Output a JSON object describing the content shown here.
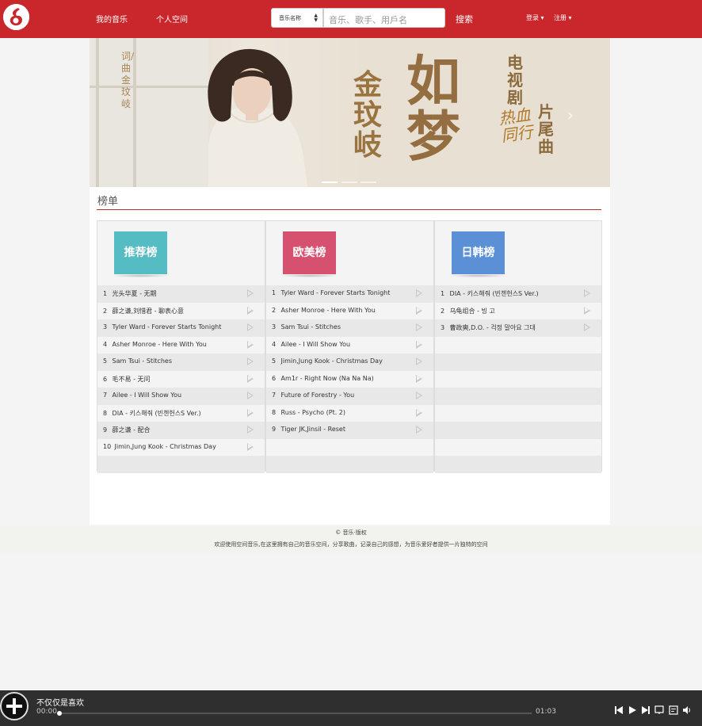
{
  "nav": {
    "my_music": "我的音乐",
    "personal_space": "个人空间",
    "search_type": "音乐名称",
    "search_placeholder": "音乐、歌手、用戶名",
    "search_button": "搜索",
    "login": "登录",
    "register": "注册"
  },
  "banner": {
    "lyricist": "词/曲 金玟岐",
    "singer": "金玟岐",
    "song": "如梦",
    "drama": "电视剧",
    "drama_name": "热血同行",
    "type": "片尾曲"
  },
  "section_title": "榜单",
  "boards": [
    {
      "name": "推荐榜",
      "color": "#55bcc3",
      "songs": [
        {
          "num": "1",
          "title": "光头华夏 - 无期"
        },
        {
          "num": "2",
          "title": "薛之谦,刘惜君 - 聊表心意"
        },
        {
          "num": "3",
          "title": "Tyler Ward - Forever Starts Tonight"
        },
        {
          "num": "4",
          "title": "Asher Monroe - Here With You"
        },
        {
          "num": "5",
          "title": "Sam Tsui - Stitches"
        },
        {
          "num": "6",
          "title": "毛不易 - 无问"
        },
        {
          "num": "7",
          "title": "Ailee - I Will Show You"
        },
        {
          "num": "8",
          "title": "DIA - 키스해줘 (빈첸헌스S Ver.)"
        },
        {
          "num": "9",
          "title": "薛之谦 - 配合"
        },
        {
          "num": "10",
          "title": "Jimin,Jung Kook - Christmas Day"
        }
      ]
    },
    {
      "name": "欧美榜",
      "color": "#d6506f",
      "songs": [
        {
          "num": "1",
          "title": "Tyler Ward - Forever Starts Tonight"
        },
        {
          "num": "2",
          "title": "Asher Monroe - Here With You"
        },
        {
          "num": "3",
          "title": "Sam Tsui - Stitches"
        },
        {
          "num": "4",
          "title": "Ailee - I Will Show You"
        },
        {
          "num": "5",
          "title": "Jimin,Jung Kook - Christmas Day"
        },
        {
          "num": "6",
          "title": "Am1r - Right Now (Na Na Na)"
        },
        {
          "num": "7",
          "title": "Future of Forestry - You"
        },
        {
          "num": "8",
          "title": "Russ - Psycho (Pt. 2)"
        },
        {
          "num": "9",
          "title": "Tiger JK,Jinsil - Reset"
        }
      ]
    },
    {
      "name": "日韩榜",
      "color": "#5b8fd6",
      "songs": [
        {
          "num": "1",
          "title": "DIA - 키스해줘 (빈첸헌스S Ver.)"
        },
        {
          "num": "2",
          "title": "乌龟组合 - 빙 고"
        },
        {
          "num": "3",
          "title": "曹政奭,D.O. - 걱정 말아요 그대"
        }
      ]
    }
  ],
  "footer": {
    "copyright": "© 音乐·版权",
    "tagline": "欢迎使用空间音乐,在这里拥有自己的音乐空间，分享歌曲，记录自己的感想，为音乐爱好者提供一片独特的空间"
  },
  "player": {
    "title": "不仅仅是喜欢",
    "current_time": "00:00",
    "total_time": "01:03",
    "progress": 0
  },
  "colors": {
    "brand": "#c9272c",
    "player_bg": "#2f2f2f"
  }
}
